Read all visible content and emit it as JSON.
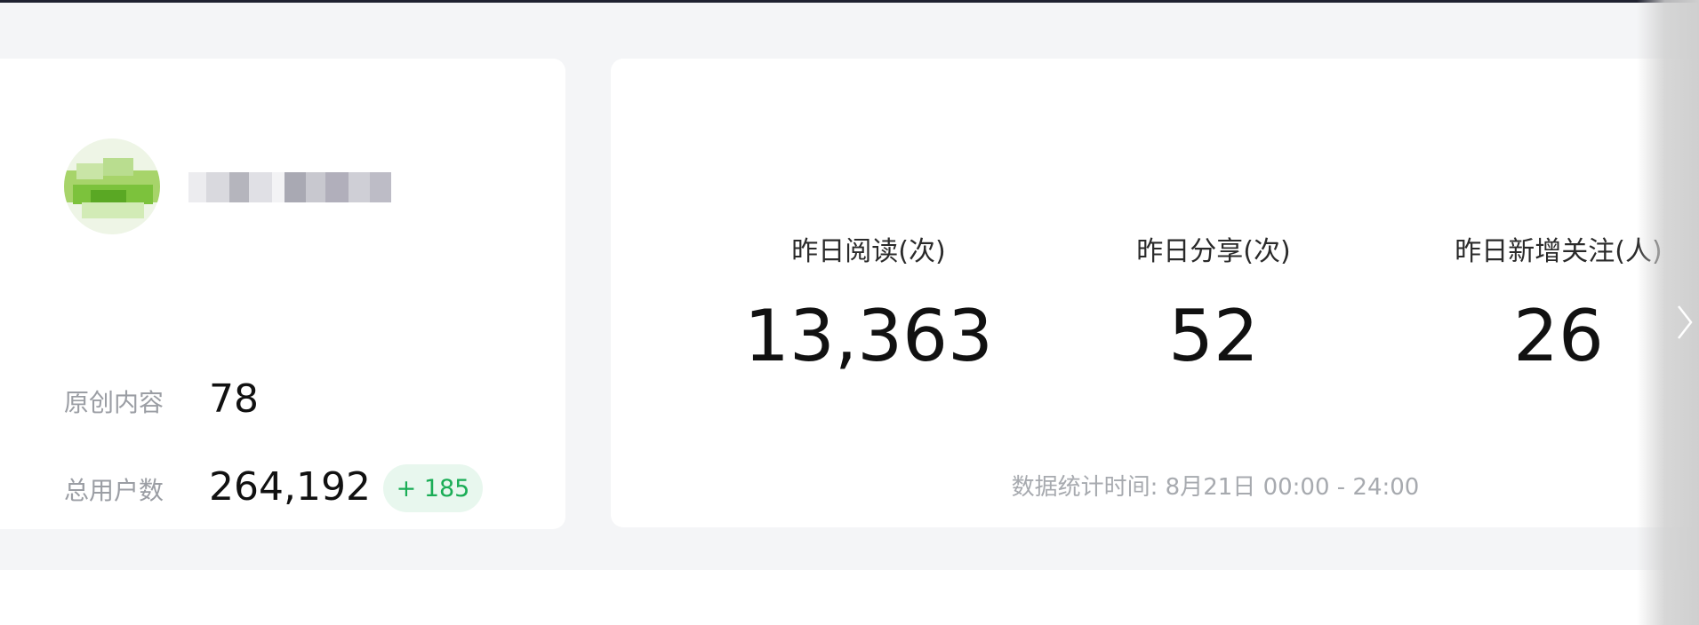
{
  "profile": {
    "original_content_label": "原创内容",
    "original_content_value": "78",
    "total_users_label": "总用户数",
    "total_users_value": "264,192",
    "total_users_delta": "+ 185"
  },
  "stats": {
    "items": [
      {
        "label": "昨日阅读(次)",
        "value": "13,363"
      },
      {
        "label": "昨日分享(次)",
        "value": "52"
      },
      {
        "label": "昨日新增关注(人)",
        "value": "26"
      }
    ],
    "footer": "数据统计时间: 8月21日 00:00 - 24:00"
  },
  "icons": {
    "next": "chevron-right-icon"
  },
  "colors": {
    "accent_green": "#1aad56",
    "badge_bg": "#e8f7ee",
    "page_bg": "#f4f5f7"
  }
}
